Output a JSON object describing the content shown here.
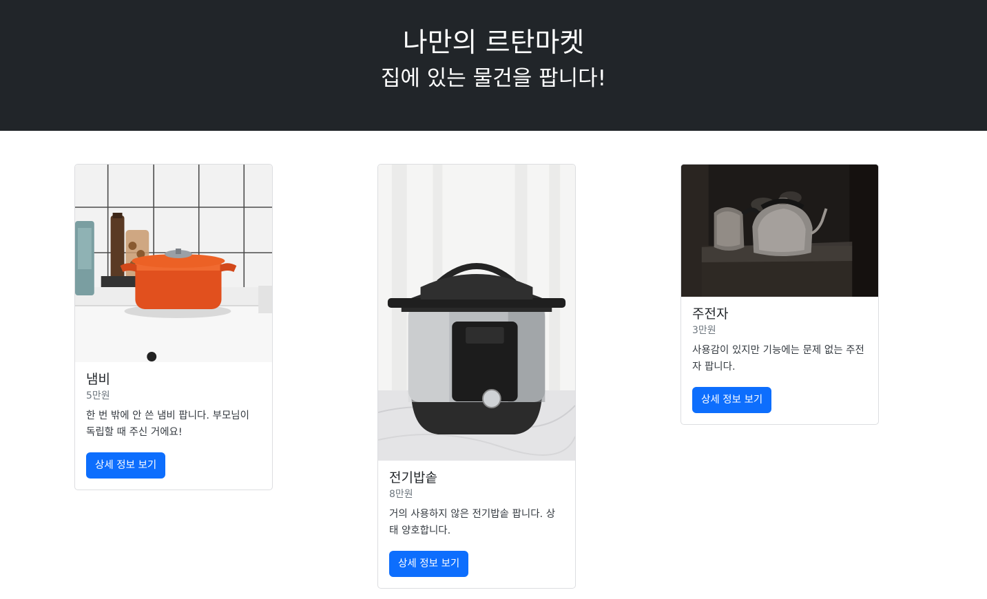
{
  "header": {
    "title": "나만의 르탄마켓",
    "subtitle": "집에 있는 물건을 팝니다!"
  },
  "colors": {
    "header_bg": "#212529",
    "button_bg": "#0d6efd",
    "muted_text": "#6c757d"
  },
  "products": [
    {
      "name": "냄비",
      "price": "5만원",
      "description": "한 번 밖에 안 쓴 냄비 팝니다. 부모님이 독립할 때 주신 거에요!",
      "button_label": "상세 정보 보기",
      "image": "orange-pot-photo"
    },
    {
      "name": "전기밥솥",
      "price": "8만원",
      "description": "거의 사용하지 않은 전기밥솥 팝니다. 상태 양호합니다.",
      "button_label": "상세 정보 보기",
      "image": "instant-pot-photo"
    },
    {
      "name": "주전자",
      "price": "3만원",
      "description": "사용감이 있지만 기능에는 문제 없는 주전자 팝니다.",
      "button_label": "상세 정보 보기",
      "image": "kettle-photo"
    }
  ]
}
